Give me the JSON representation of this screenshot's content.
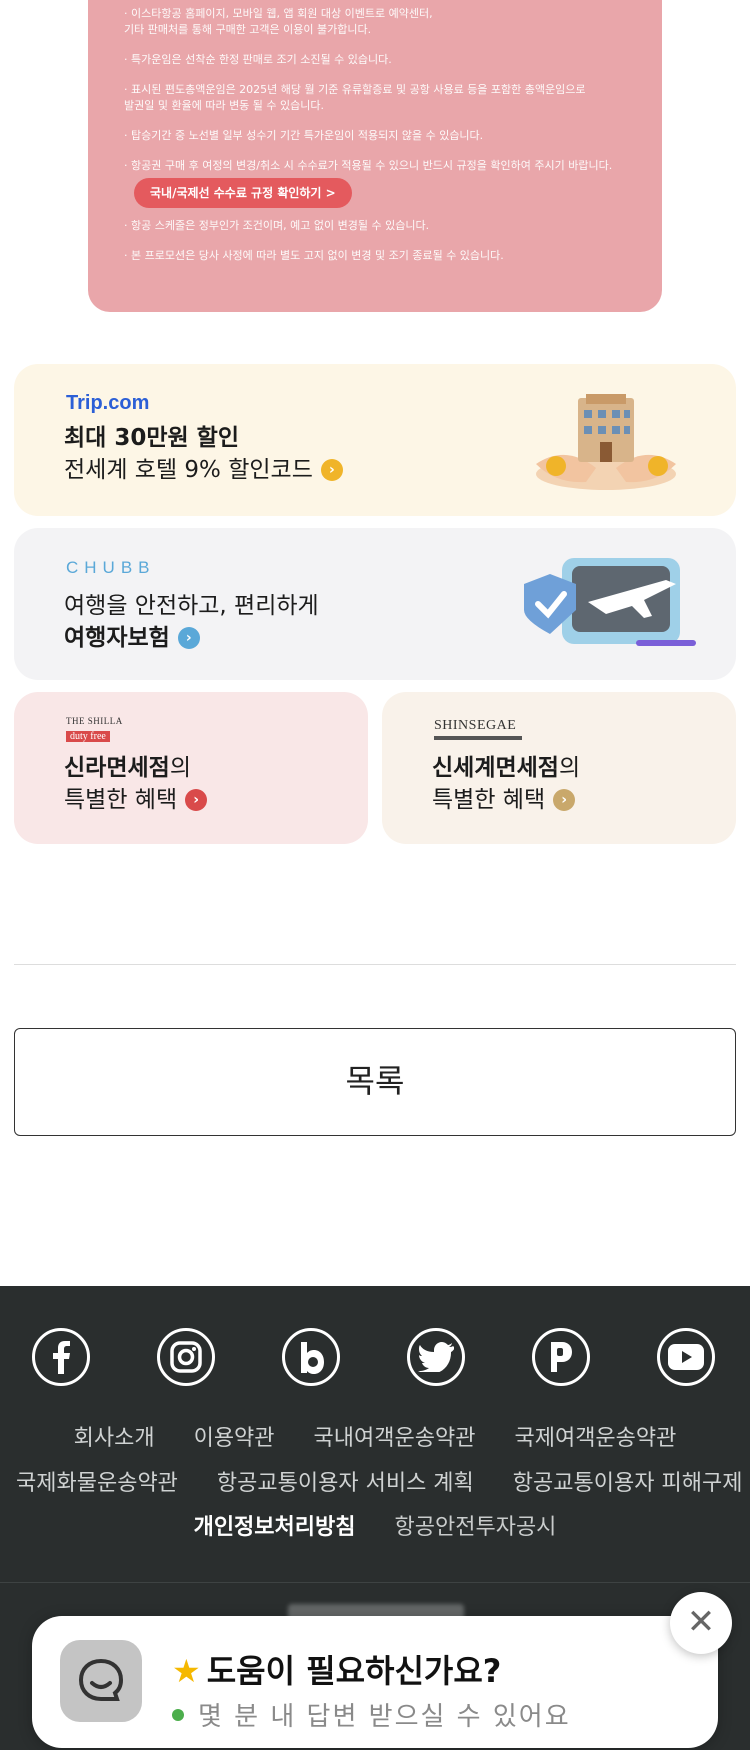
{
  "notice": {
    "lines": [
      "· 이스타항공 홈페이지, 모바일 웹, 앱 회원 대상 이벤트로 예약센터,",
      "  기타 판매처를 통해 구매한 고객은 이용이 불가합니다.",
      "· 특가운임은 선착순 한정 판매로 조기 소진될 수 있습니다.",
      "· 표시된 편도총액운임은 2025년 해당 월 기준 유류할증료 및 공항 사용료 등을 포함한 총액운임으로",
      "  발권일 및 환율에 따라 변동 될 수 있습니다.",
      "· 탑승기간 중 노선별 일부 성수기 기간 특가운임이 적용되지 않을 수 있습니다.",
      "· 항공권 구매 후 여정의 변경/취소 시 수수료가 적용될 수 있으니 반드시 규정을 확인하여 주시기 바랍니다.",
      "· 항공 스케줄은 정부인가 조건이며, 예고 없이 변경될 수 있습니다.",
      "· 본 프로모션은 당사 사정에 따라 별도 고지 없이 변경 및 조기 종료될 수 있습니다."
    ],
    "fee_button": "국내/국제선 수수료 규정 확인하기 >"
  },
  "promos": {
    "trip": {
      "brand": "Trip.com",
      "line1": "최대 30만원 할인",
      "line2": "전세계 호텔 9% 할인코드",
      "arrow_color": "#f0b429"
    },
    "chubb": {
      "brand": "CHUBB",
      "line1": "여행을 안전하고, 편리하게",
      "line2": "여행자보험",
      "arrow_color": "#5aa8d8"
    },
    "shilla": {
      "brand_top": "THE SHILLA",
      "brand_sub": "duty free",
      "line1_bold": "신라면세점",
      "line1_rest": "의",
      "line2": "특별한 혜택",
      "arrow_color": "#d94a4a"
    },
    "shinsegae": {
      "brand": "SHINSEGAE",
      "line1_bold": "신세계면세점",
      "line1_rest": "의",
      "line2": "특별한 혜택",
      "arrow_color": "#c9a86b"
    }
  },
  "list_button": "목록",
  "footer": {
    "social": [
      "facebook-icon",
      "instagram-icon",
      "blog-icon",
      "twitter-icon",
      "post-icon",
      "youtube-icon"
    ],
    "links_row1": [
      "회사소개",
      "이용약관",
      "국내여객운송약관",
      "국제여객운송약관"
    ],
    "links_row2": [
      "국제화물운송약관",
      "항공교통이용자 서비스 계획",
      "항공교통이용자 피해구제"
    ],
    "links_row3": [
      "개인정보처리방침",
      "항공안전투자공시"
    ]
  },
  "chat": {
    "title": "도움이 필요하신가요?",
    "subtitle": "몇 분 내 답변 받으실 수 있어요"
  }
}
